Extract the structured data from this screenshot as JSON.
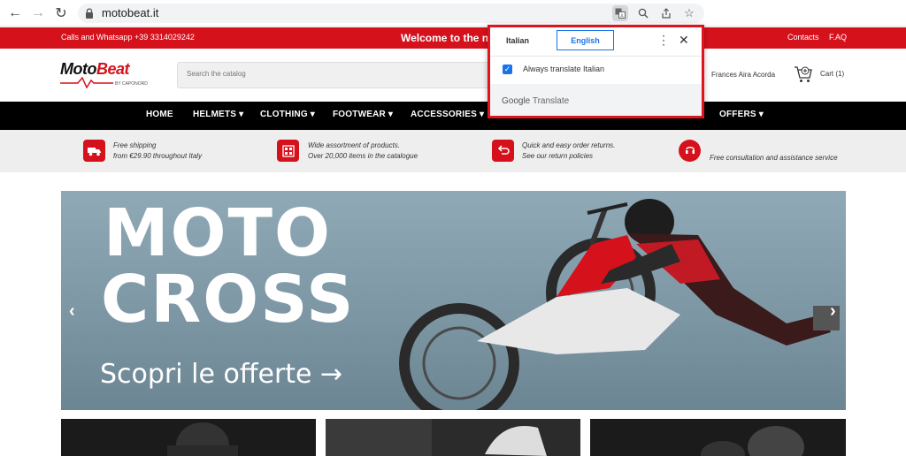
{
  "browser": {
    "url": "motobeat.it"
  },
  "topbar": {
    "calls": "Calls and Whatsapp +39 3314029242",
    "welcome": "Welcome to the new",
    "contacts": "Contacts",
    "faq": "F.AQ"
  },
  "header": {
    "logo_main_1": "Moto",
    "logo_main_2": "Beat",
    "logo_sub": "BY CAPONORD",
    "search_placeholder": "Search the catalog",
    "user_name": "Frances Aira Acorda",
    "cart_label": "Cart (1)"
  },
  "nav": {
    "items": [
      "HOME",
      "HELMETS ▾",
      "CLOTHING ▾",
      "FOOTWEAR ▾",
      "ACCESSORIES ▾",
      "OFFERS ▾"
    ]
  },
  "features": [
    {
      "line1": "Free shipping",
      "line2": "from €29.90 throughout Italy",
      "icon": "truck-icon"
    },
    {
      "line1": "Wide assortment of products.",
      "line2": "Over 20,000 items in the catalogue",
      "icon": "catalog-icon"
    },
    {
      "line1": "Quick and easy order returns.",
      "line2": "See our return policies",
      "icon": "return-icon"
    },
    {
      "line1": "Free consultation and assistance service",
      "line2": "",
      "icon": "support-icon"
    }
  ],
  "hero": {
    "line1": "MOTO",
    "line2": "CROSS",
    "cta": "Scopri le offerte →"
  },
  "translate_popup": {
    "tab_source": "Italian",
    "tab_target": "English",
    "always_label": "Always translate Italian",
    "brand_google": "Google",
    "brand_translate": "Translate"
  },
  "colors": {
    "brand_red": "#d5111c",
    "popup_highlight": "#e0141f",
    "google_blue": "#1a73e8"
  }
}
